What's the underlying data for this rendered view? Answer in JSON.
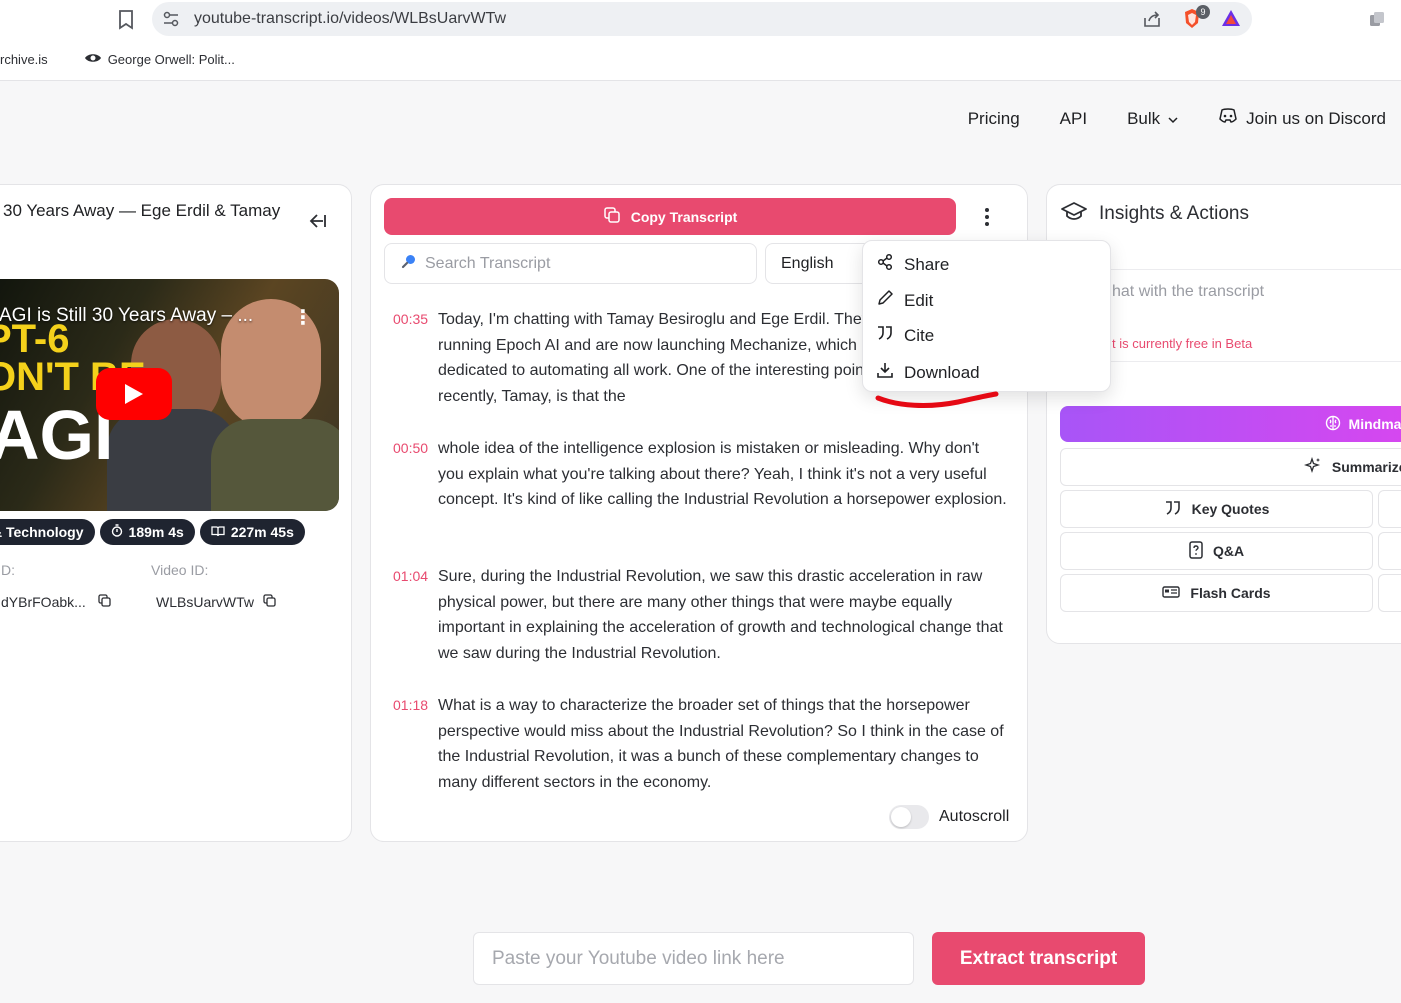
{
  "browser": {
    "url": "youtube-transcript.io/videos/WLBsUarvWTw",
    "brave_badge": "9",
    "bookmarks": [
      "rchive.is",
      "George Orwell: Polit..."
    ]
  },
  "nav": {
    "pricing": "Pricing",
    "api": "API",
    "bulk": "Bulk",
    "discord": "Join us on Discord"
  },
  "video": {
    "title": "30 Years Away — Ege Erdil & Tamay",
    "thumbnail_title": "AGI is Still 30 Years Away – ...",
    "thumbnail_big_text": [
      "PT-6",
      "ON'T BE",
      "AGI"
    ],
    "chips": [
      "& Technology",
      "189m 4s",
      "227m 45s"
    ],
    "left_id_label": "D:",
    "left_id_value": "dYBrFOabk...",
    "video_id_label": "Video ID:",
    "video_id_value": "WLBsUarvWTw"
  },
  "transcript": {
    "copy_label": "Copy Transcript",
    "search_placeholder": "Search Transcript",
    "language": "English",
    "segments": [
      {
        "time": "00:35",
        "text": "Today, I'm chatting with Tamay Besiroglu and Ege Erdil. They were previously running Epoch AI and are now launching Mechanize, which is a company dedicated to automating all work. One of the interesting points you made recently, Tamay, is that the"
      },
      {
        "time": "00:50",
        "text": "whole idea of the intelligence explosion is mistaken or misleading. Why don't you explain what you're talking about there? Yeah, I think it's not a very useful concept. It's kind of like calling the Industrial Revolution a horsepower explosion."
      },
      {
        "time": "01:04",
        "text": "Sure, during the Industrial Revolution, we saw this drastic acceleration in raw physical power, but there are many other things that were maybe equally important in explaining the acceleration of growth and technological change that we saw during the Industrial Revolution."
      },
      {
        "time": "01:18",
        "text": "What is a way to characterize the broader set of things that the horsepower perspective would miss about the Industrial Revolution? So I think in the case of the Industrial Revolution, it was a bunch of these complementary changes to many different sectors in the economy."
      }
    ],
    "autoscroll_label": "Autoscroll"
  },
  "menu": {
    "share": "Share",
    "edit": "Edit",
    "cite": "Cite",
    "download": "Download"
  },
  "insights": {
    "title": "Insights & Actions",
    "chat_placeholder": "hat with the transcript",
    "beta_note": "t is currently free in Beta",
    "mindmap": "Mindmap",
    "summarize": "Summarize T",
    "key_quotes": "Key Quotes",
    "qa": "Q&A",
    "flash_cards": "Flash Cards"
  },
  "bottom": {
    "paste_placeholder": "Paste your Youtube video link here",
    "extract_label": "Extract transcript"
  },
  "colors": {
    "accent": "#e84a6f",
    "chip_bg": "#1f2430",
    "mindmap_gradient": [
      "#a855f7",
      "#d946ef"
    ]
  }
}
